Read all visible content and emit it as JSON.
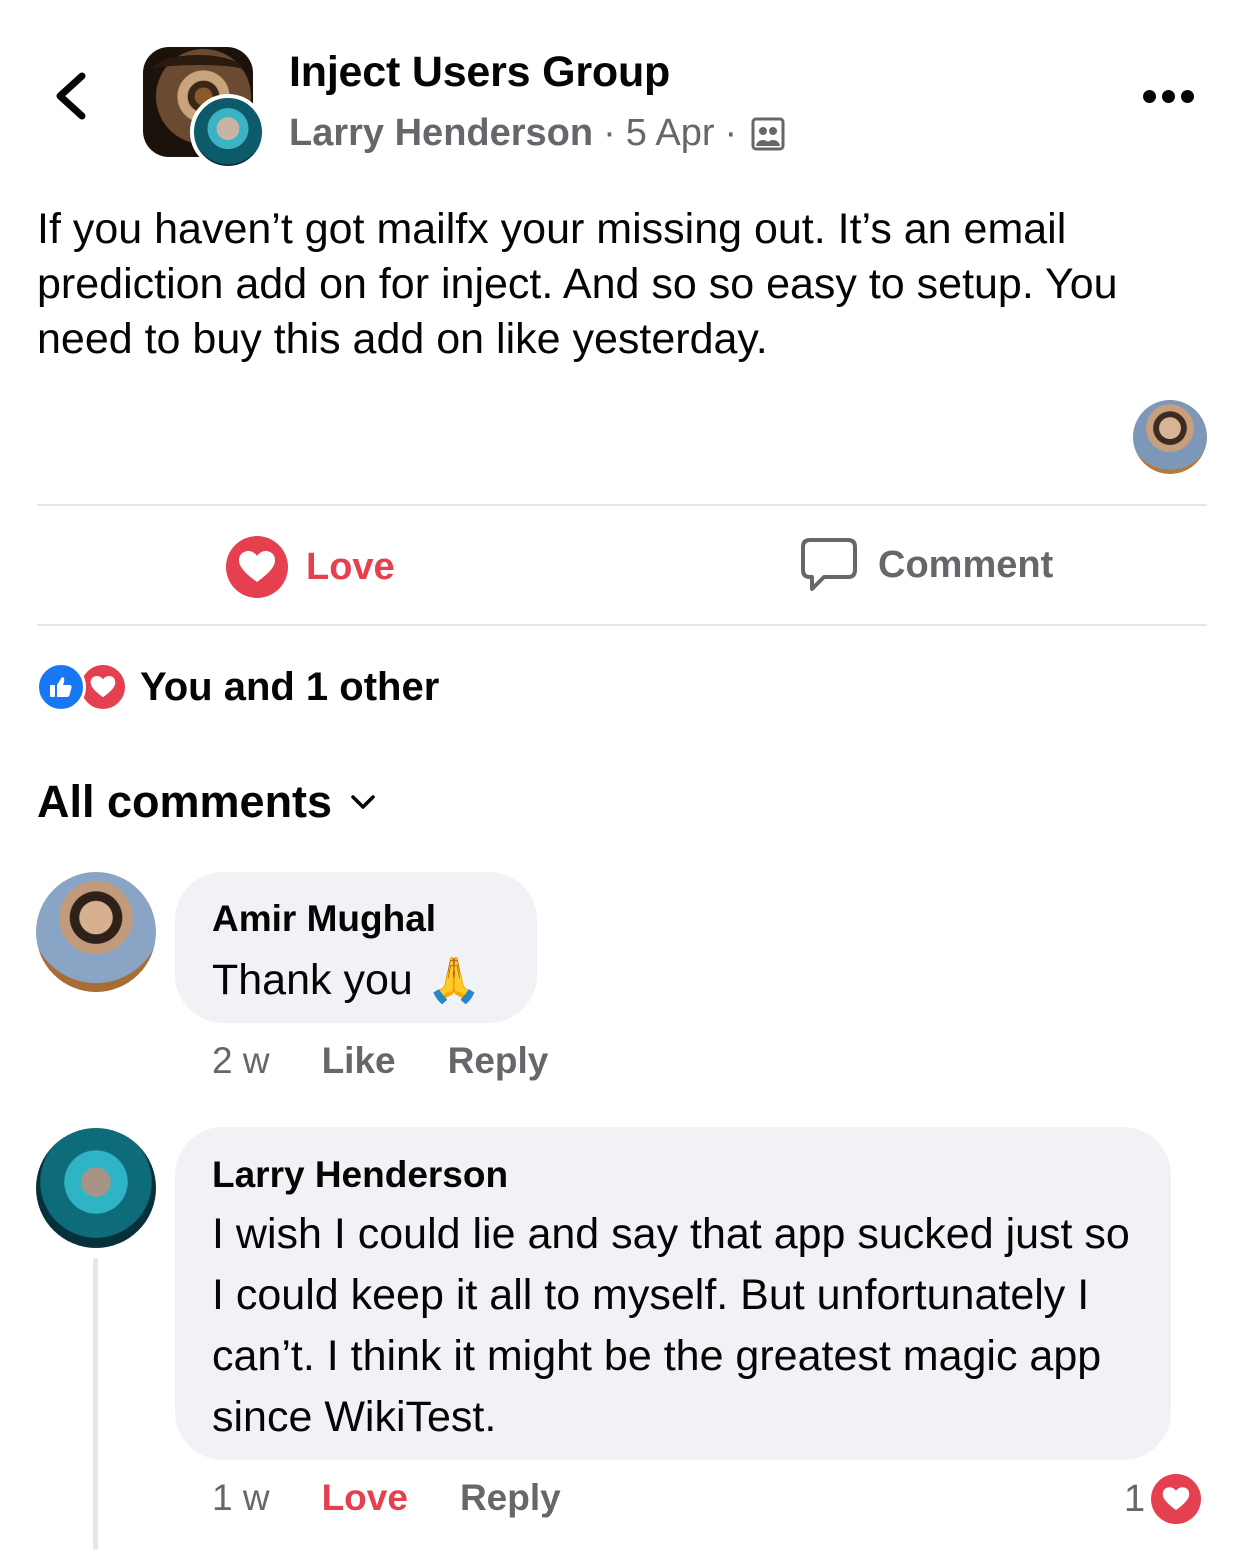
{
  "header": {
    "group_name": "Inject Users Group",
    "author": "Larry Henderson",
    "separator": "·",
    "date": "5 Apr",
    "audience_icon": "group-icon",
    "more_icon": "more-dots-icon",
    "back_icon": "chevron-left-icon"
  },
  "post": {
    "text": "If you haven’t got mailfx your missing out. It’s an email prediction add on for inject. And so so easy to setup. You need to buy this add on like yesterday."
  },
  "actions": {
    "love_label": "Love",
    "comment_label": "Comment"
  },
  "reactions": {
    "summary": "You and 1 other"
  },
  "comments_section": {
    "filter_label": "All comments"
  },
  "comments": [
    {
      "author": "Amir Mughal",
      "text": "Thank you",
      "emoji": "🙏",
      "time": "2 w",
      "like_label": "Like",
      "reply_label": "Reply"
    },
    {
      "author": "Larry Henderson",
      "text": "I wish I could lie and say that app sucked just so I could keep it all to myself.  But unfortunately I can’t. I think it might be the greatest magic app since WikiTest.",
      "time": "1 w",
      "love_label": "Love",
      "reply_label": "Reply",
      "reaction_count": "1"
    }
  ],
  "colors": {
    "love_red": "#e4404f",
    "like_blue": "#1877f2",
    "muted_text": "#65676b",
    "bubble_bg": "#f0f2f5"
  }
}
